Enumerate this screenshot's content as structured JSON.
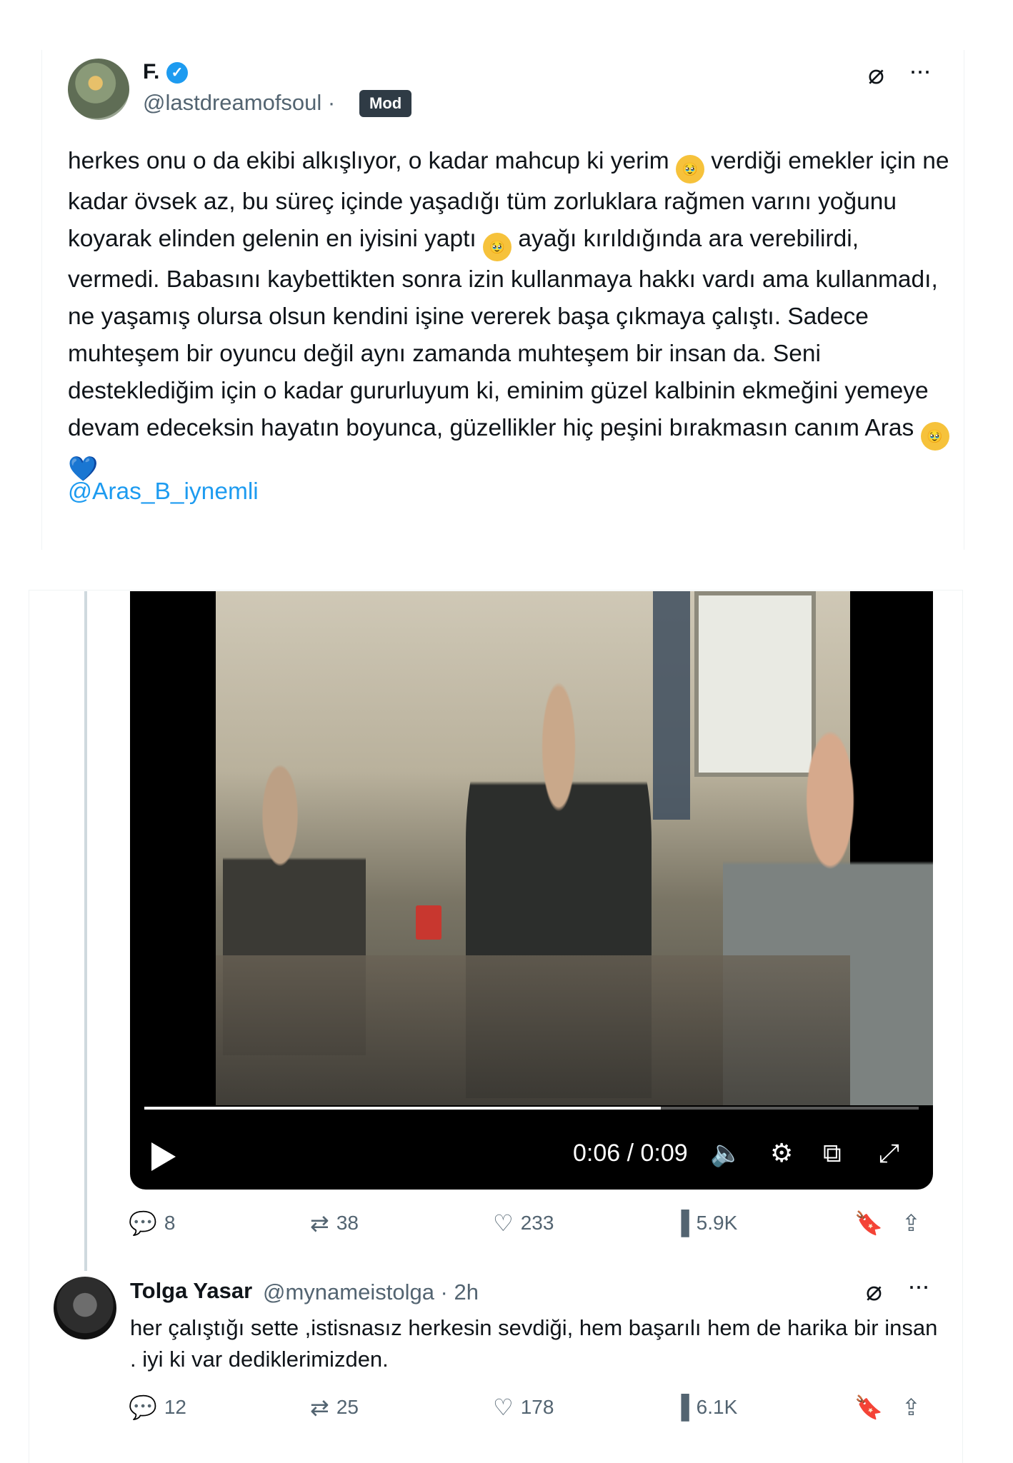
{
  "post": {
    "author_name": "F.",
    "verified_mark": "✓",
    "handle": "@lastdreamofsoul ·",
    "badge": "Mod",
    "text_parts": [
      "herkes onu o da ekibi alkışlıyor, o kadar mahcup ki yerim ",
      " verdiği emekler için ne kadar övsek az, bu süreç içinde yaşadığı tüm zorluklara rağmen varını yoğunu koyarak elinden gelenin en iyisini yaptı ",
      " ayağı kırıldığında ara verebilirdi, vermedi. Babasını kaybettikten sonra izin kullanmaya hakkı vardı ama kullanmadı, ne yaşamış olursa olsun kendini işine vererek başa çıkmaya çalıştı. Sadece muhteşem bir oyuncu değil aynı zamanda muhteşem bir insan da. Seni desteklediğim için o kadar gururluyum ki, eminim güzel kalbinin ekmeğini yemeye devam edeceksin hayatın boyunca, güzellikler hiç peşini bırakmasın canım Aras "
    ],
    "emoji": "🥹",
    "heart": "💙",
    "mention": "@Aras_B_iynemli"
  },
  "icons": {
    "grok": "grok-icon",
    "more": "more-icon",
    "reply": "reply-icon",
    "retweet": "retweet-icon",
    "like": "like-icon",
    "views": "views-icon",
    "bookmark": "bookmark-icon",
    "share": "share-icon"
  },
  "video": {
    "time": "0:06 / 0:09",
    "progress": 0.667
  },
  "quote_actions": {
    "replies": "8",
    "retweets": "38",
    "likes": "233",
    "views": "5.9K"
  },
  "reply": {
    "author_name": "Tolga Yasar",
    "handle": "@mynameistolga · 2h",
    "text": "her çalıştığı sette ,istisnasız herkesin sevdiği, hem başarılı hem de harika bir insan . iyi ki var dediklerimizden.",
    "replies": "12",
    "retweets": "25",
    "likes": "178",
    "views": "6.1K"
  },
  "colors": {
    "accent": "#1d9bf0",
    "muted": "#536471",
    "badge_bg": "#2f3b45"
  }
}
